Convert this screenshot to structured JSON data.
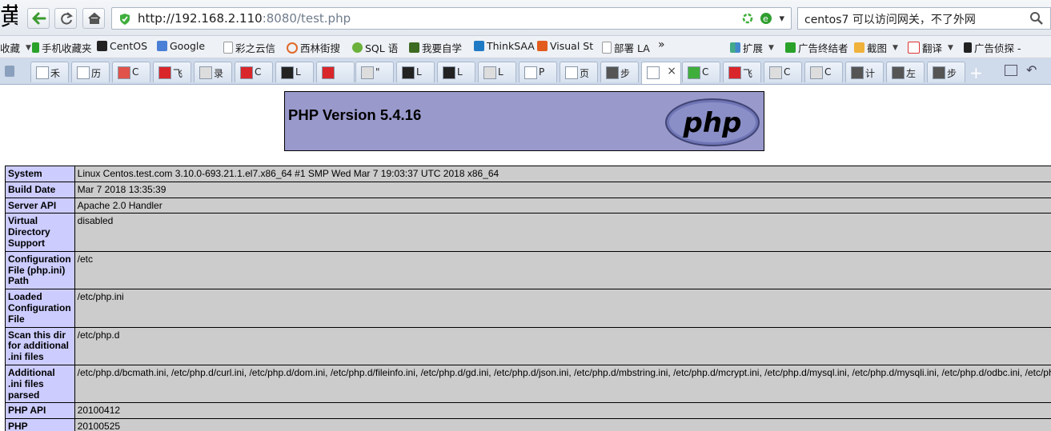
{
  "browser": {
    "logo_glyph": "黄",
    "url": {
      "host": "http://192.168.2.110",
      "rest": ":8080/test.php"
    },
    "search_text": "centos7 可以访问网关，不了外网",
    "bookmarks": [
      {
        "label": "收藏",
        "arrow": "▼"
      },
      {
        "label": "手机收藏夹"
      },
      {
        "label": "CentOS"
      },
      {
        "label": "Google"
      },
      {
        "label": "彩之云信"
      },
      {
        "label": "西林街搜"
      },
      {
        "label": "SQL 语"
      },
      {
        "label": "我要自学"
      },
      {
        "label": "ThinkSAA"
      },
      {
        "label": "Visual St"
      },
      {
        "label": "部署 LA"
      },
      {
        "label": "»"
      },
      {
        "label": "扩展",
        "arrow": "▼"
      },
      {
        "label": "广告终结者"
      },
      {
        "label": "截图",
        "arrow": "▼"
      },
      {
        "label": "翻译",
        "arrow": "▼"
      },
      {
        "label": "广告侦探 -"
      }
    ],
    "tabs": [
      "禾",
      "历",
      "C",
      "飞",
      "录",
      "C",
      "L",
      "",
      "\"",
      "L",
      "L",
      "L",
      "P",
      "页",
      "步",
      "",
      "C",
      "飞",
      "C",
      "C",
      "计",
      "左",
      "步"
    ],
    "active_tab_close": "×",
    "colors": {
      "accent_red": "#d9262b",
      "tab_bg": "#cfdaea",
      "php_purple": "#9999cc"
    }
  },
  "page": {
    "title": "PHP Version 5.4.16",
    "logo_text": "php",
    "rows": [
      {
        "label": "System",
        "value": "Linux Centos.test.com 3.10.0-693.21.1.el7.x86_64 #1 SMP Wed Mar 7 19:03:37 UTC 2018 x86_64"
      },
      {
        "label": "Build Date",
        "value": "Mar 7 2018 13:35:39"
      },
      {
        "label": "Server API",
        "value": "Apache 2.0 Handler"
      },
      {
        "label": "Virtual Directory Support",
        "value": "disabled"
      },
      {
        "label": "Configuration File (php.ini) Path",
        "value": "/etc"
      },
      {
        "label": "Loaded Configuration File",
        "value": "/etc/php.ini"
      },
      {
        "label": "Scan this dir for additional .ini files",
        "value": "/etc/php.d"
      },
      {
        "label": "Additional .ini files parsed",
        "value": "/etc/php.d/bcmath.ini, /etc/php.d/curl.ini, /etc/php.d/dom.ini, /etc/php.d/fileinfo.ini, /etc/php.d/gd.ini, /etc/php.d/json.ini, /etc/php.d/mbstring.ini, /etc/php.d/mcrypt.ini, /etc/php.d/mysql.ini, /etc/php.d/mysqli.ini, /etc/php.d/odbc.ini, /etc/php.d/pdo.ini"
      },
      {
        "label": "PHP API",
        "value": "20100412"
      },
      {
        "label": "PHP Extension",
        "value": "20100525"
      }
    ]
  }
}
